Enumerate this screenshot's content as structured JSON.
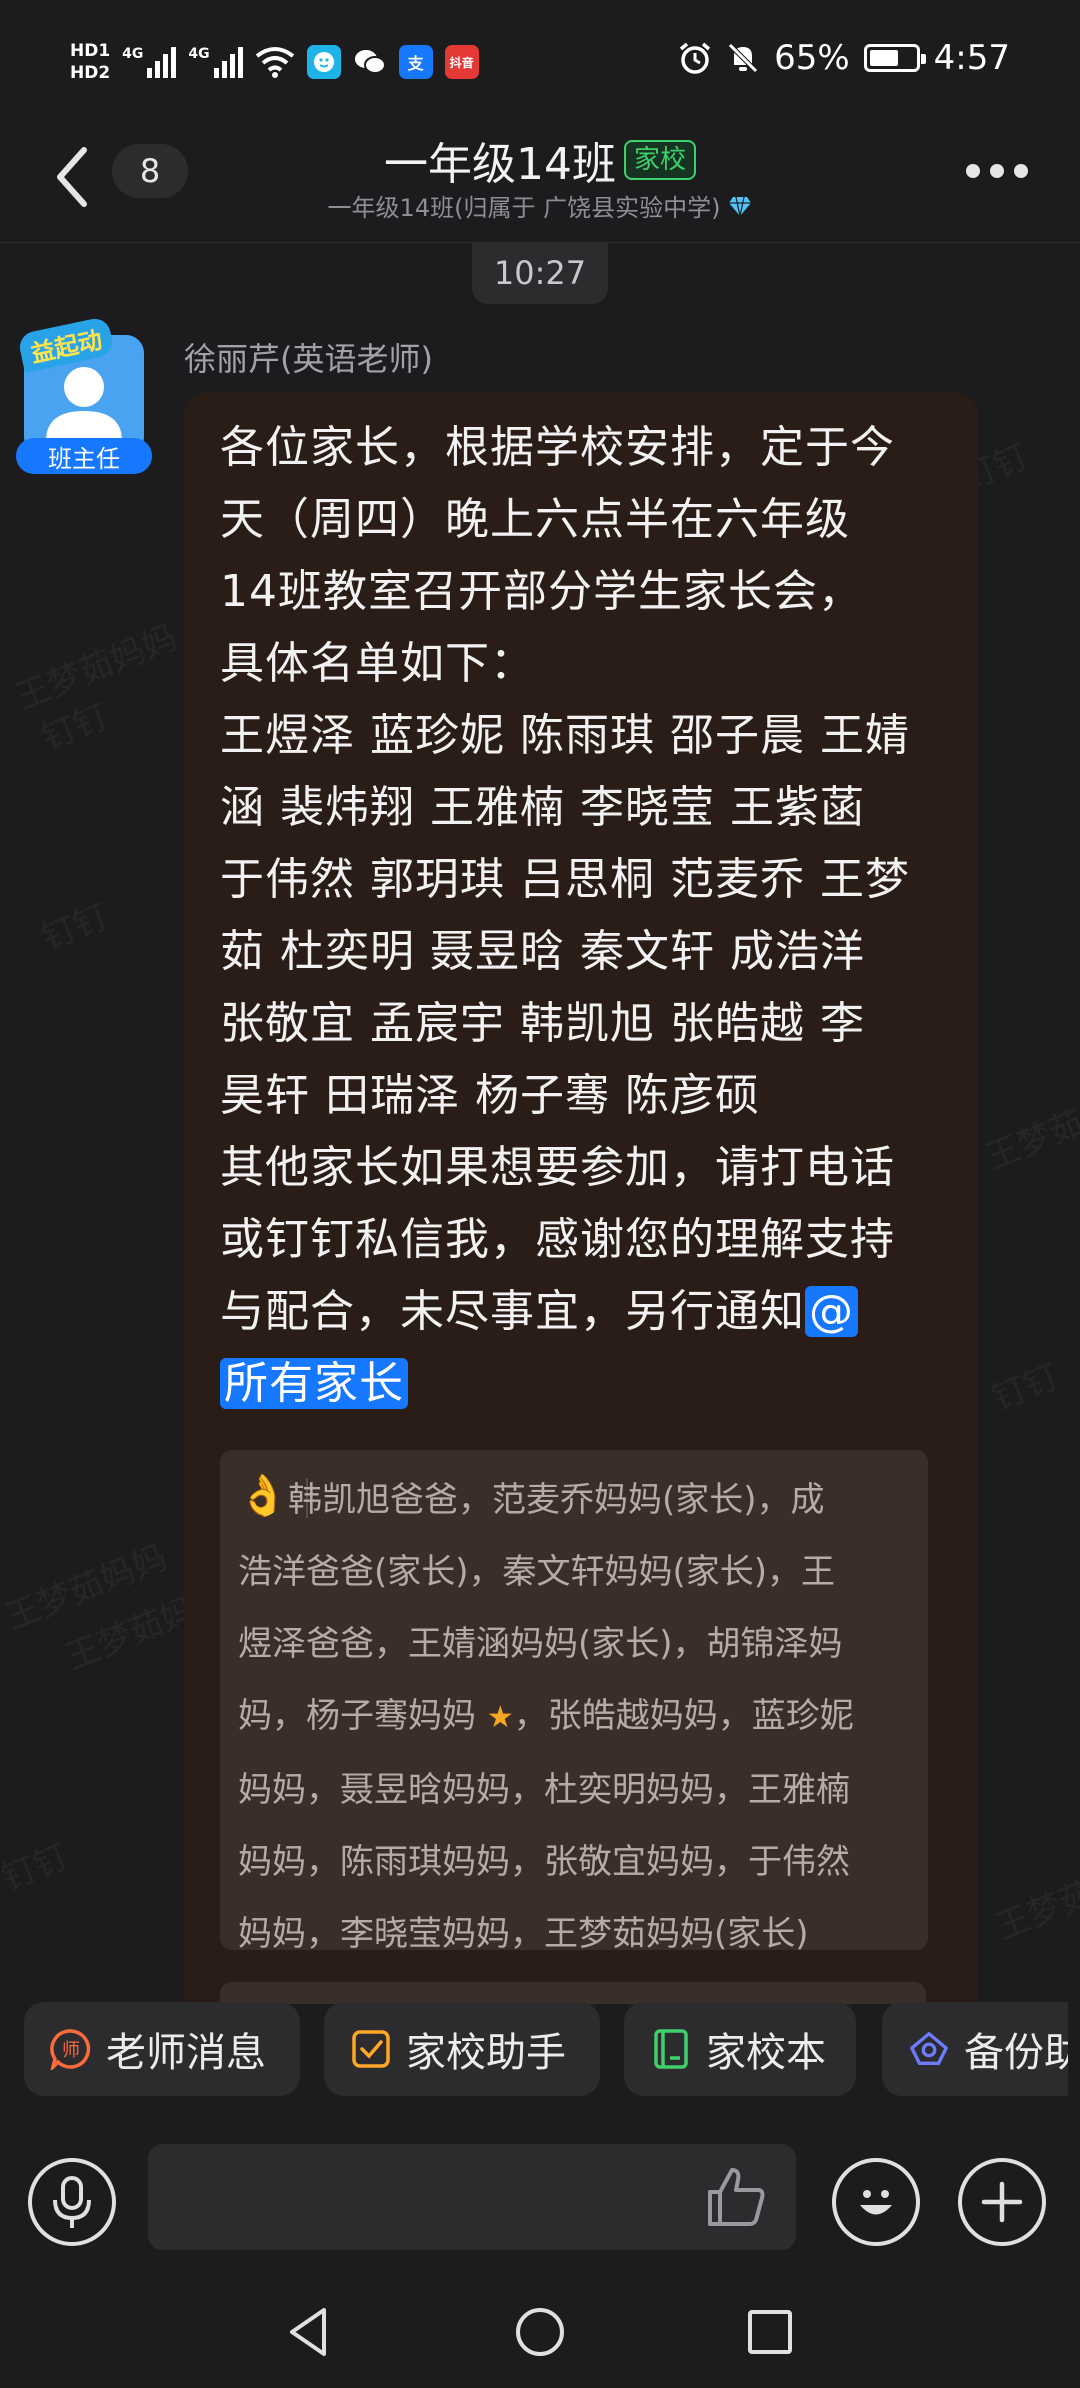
{
  "status_bar": {
    "hd1": "HD1",
    "hd2": "HD2",
    "sim1": "4G",
    "sim2": "4G",
    "app_douyin": "抖音",
    "app_alipay": "支",
    "battery": "65%",
    "battery_level": 0.65,
    "time": "4:57"
  },
  "header": {
    "unread_count": "8",
    "title": "一年级14班",
    "tag": "家校",
    "subtitle": "一年级14班(归属于 广饶县实验中学)"
  },
  "chat": {
    "time_divider": "10:27",
    "sender": {
      "name": "徐丽芹(英语老师)",
      "badge_top": "益起动",
      "badge_bottom": "班主任"
    },
    "message_lines": [
      "各位家长，根据学校安排，定于今",
      "天（周四）晚上六点半在六年级",
      "14班教室召开部分学生家长会，",
      "具体名单如下：",
      "王煜泽 蓝珍妮 陈雨琪 邵子晨 王婧",
      "涵 裴炜翔 王雅楠 李晓莹 王紫菡",
      "于伟然 郭玥琪 吕思桐 范麦乔 王梦",
      "茹 杜奕明 聂昱晗 秦文轩 成浩洋",
      "张敬宜 孟宸宇  韩凯旭 张皓越  李",
      "昊轩 田瑞泽 杨子骞 陈彦硕",
      "其他家长如果想要参加，请打电话",
      "或钉钉私信我，感谢您的理解支持",
      "与配合，未尽事宜，另行通知"
    ],
    "mention_part1": "@",
    "mention_part2": "所有家长",
    "reaction_emoji": "👌",
    "reaction_lines": [
      "韩凯旭爸爸，范麦乔妈妈(家长)，成",
      "浩洋爸爸(家长)，秦文轩妈妈(家长)，王",
      "煜泽爸爸，王婧涵妈妈(家长)，胡锦泽妈",
      "妈，杨子骞妈妈",
      "，张皓越妈妈，蓝珍妮",
      "妈妈，聂昱晗妈妈，杜奕明妈妈，王雅楠",
      "妈妈，陈雨琪妈妈，张敬宜妈妈，于伟然",
      "妈妈，李晓莹妈妈，王梦茹妈妈(家长)"
    ],
    "watermarks": [
      "钉钉",
      "王梦茹妈妈",
      "钉钉",
      "王梦茹妈妈",
      "钉钉",
      "王梦茹妈妈",
      "钉钉",
      "王梦茹妈妈",
      "钉钉",
      "王梦茹妈妈"
    ]
  },
  "quick_actions": [
    {
      "label": "老师消息",
      "icon": "teacher-icon",
      "color": "#ff6a3d"
    },
    {
      "label": "家校助手",
      "icon": "check-icon",
      "color": "#ffa726"
    },
    {
      "label": "家校本",
      "icon": "notebook-icon",
      "color": "#3fcf6b"
    },
    {
      "label": "备份助",
      "icon": "cloud-icon",
      "color": "#6e7bff"
    }
  ]
}
